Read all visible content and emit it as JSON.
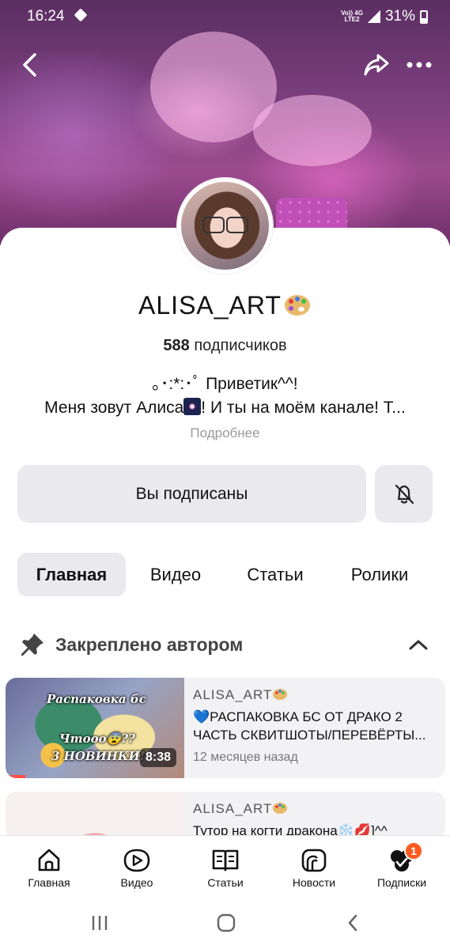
{
  "status_bar": {
    "time": "16:24",
    "network_top": "Vo)) 4G",
    "network_bottom": "LTE2",
    "battery": "31%"
  },
  "channel": {
    "name": "ALISA_ART",
    "subscribers_count": "588",
    "subscribers_label": "подписчиков",
    "description_line1": "｡･:*:･ﾟ Приветик^^!",
    "description_line2_a": "Меня зовут Алиса",
    "description_line2_b": "! И ты на моём канале! Т...",
    "more_link": "Подробнее"
  },
  "actions": {
    "subscribed_label": "Вы подписаны"
  },
  "tabs": [
    {
      "label": "Главная",
      "active": true
    },
    {
      "label": "Видео",
      "active": false
    },
    {
      "label": "Статьи",
      "active": false
    },
    {
      "label": "Ролики",
      "active": false
    }
  ],
  "pinned": {
    "title": "Закреплено автором"
  },
  "videos": [
    {
      "author": "ALISA_ART",
      "title": "💙РАСПАКОВКА БС ОТ ДРАКО 2 ЧАСТЬ СКВИТШОТЫ/ПЕРЕВЁРТЫ...",
      "meta": "12 месяцев назад",
      "duration": "8:38",
      "thumb_caption_1": "Распаковка бс",
      "thumb_caption_2": "Чтооо😨??",
      "thumb_caption_3": "3 НОВИНКИ!",
      "progress": 0.11
    },
    {
      "author": "ALISA_ART",
      "title": "Тутор на когти дракона❄️💋]^^"
    }
  ],
  "bottom_nav": [
    {
      "label": "Главная",
      "icon": "home-icon"
    },
    {
      "label": "Видео",
      "icon": "video-play-icon"
    },
    {
      "label": "Статьи",
      "icon": "book-icon"
    },
    {
      "label": "Новости",
      "icon": "news-icon"
    },
    {
      "label": "Подписки",
      "icon": "subscriptions-icon",
      "badge": "1"
    }
  ],
  "colors": {
    "accent_badge": "#ff5a1f",
    "button_bg": "#e9e9ee",
    "card_bg": "#f2f2f5",
    "muted_text": "#9a9a9a"
  }
}
